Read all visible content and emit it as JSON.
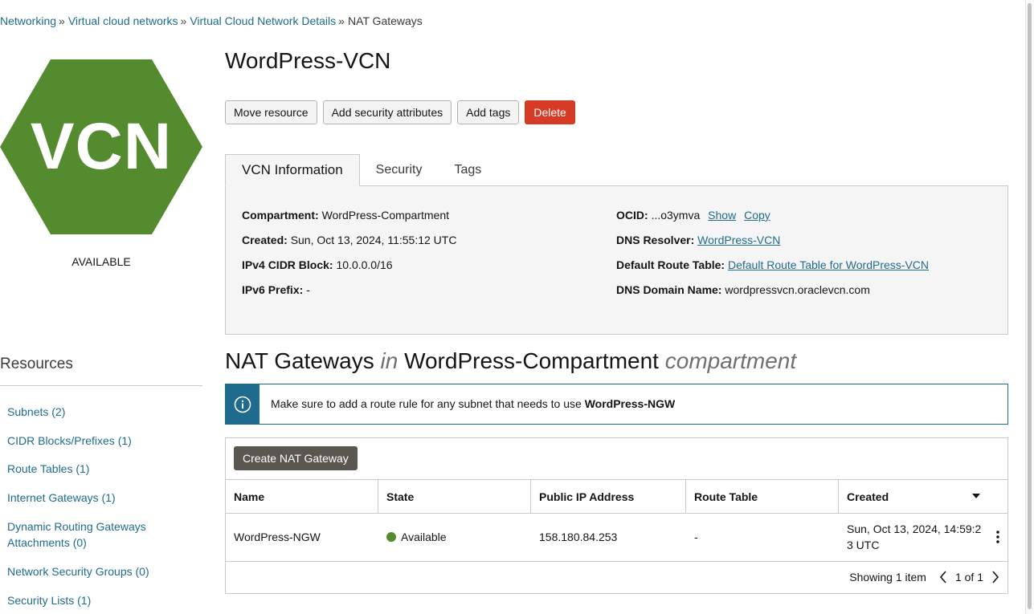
{
  "breadcrumb": {
    "items": [
      "Networking",
      "Virtual cloud networks",
      "Virtual Cloud Network Details"
    ],
    "current": "NAT Gateways",
    "separator": "»"
  },
  "badge": {
    "text": "VCN",
    "color": "#558b2f",
    "status": "AVAILABLE"
  },
  "title": "WordPress-VCN",
  "actions": {
    "move": "Move resource",
    "security_attrs": "Add security attributes",
    "tags": "Add tags",
    "delete": "Delete"
  },
  "tabs": [
    "VCN Information",
    "Security",
    "Tags"
  ],
  "info": {
    "compartment_label": "Compartment:",
    "compartment": "WordPress-Compartment",
    "created_label": "Created:",
    "created": "Sun, Oct 13, 2024, 11:55:12 UTC",
    "ipv4_label": "IPv4 CIDR Block:",
    "ipv4": "10.0.0.0/16",
    "ipv6_label": "IPv6 Prefix:",
    "ipv6": "-",
    "ocid_label": "OCID:",
    "ocid": "...o3ymva",
    "show": "Show",
    "copy": "Copy",
    "dns_resolver_label": "DNS Resolver:",
    "dns_resolver": "WordPress-VCN",
    "route_table_label": "Default Route Table:",
    "route_table": "Default Route Table for WordPress-VCN",
    "dns_domain_label": "DNS Domain Name:",
    "dns_domain": "wordpressvcn.oraclevcn.com"
  },
  "section": {
    "title": "NAT Gateways",
    "in": "in",
    "compartment": "WordPress-Compartment",
    "suffix": "compartment"
  },
  "alert": {
    "text": "Make sure to add a route rule for any subnet that needs to use ",
    "bold": "WordPress-NGW"
  },
  "table": {
    "create_button": "Create NAT Gateway",
    "columns": [
      "Name",
      "State",
      "Public IP Address",
      "Route Table",
      "Created"
    ],
    "rows": [
      {
        "name": "WordPress-NGW",
        "state": "Available",
        "ip": "158.180.84.253",
        "route": "-",
        "created_1": "Sun, Oct 13, 2024, 14:59:2",
        "created_2": "3 UTC"
      }
    ],
    "showing": "Showing 1 item",
    "page": "1 of 1"
  },
  "resources": {
    "title": "Resources",
    "items": [
      "Subnets (2)",
      "CIDR Blocks/Prefixes (1)",
      "Route Tables (1)",
      "Internet Gateways (1)",
      "Dynamic Routing Gateways",
      "Attachments (0)",
      "Network Security Groups (0)",
      "Security Lists (1)"
    ]
  },
  "colors": {
    "link": "#1f6b8e",
    "danger": "#d63b25",
    "available": "#558b2f"
  }
}
